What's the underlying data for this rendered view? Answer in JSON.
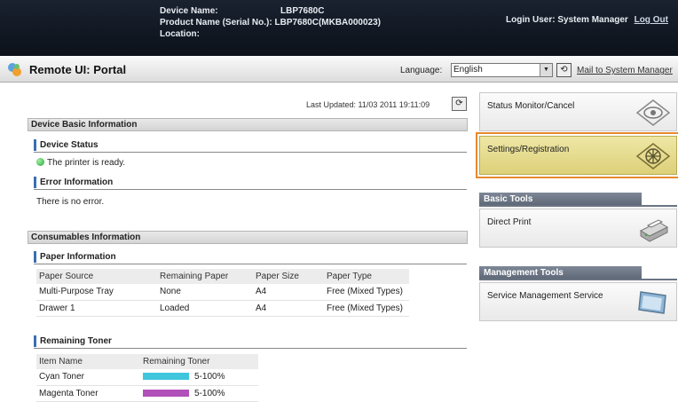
{
  "header": {
    "device_name_label": "Device Name:",
    "device_name": "LBP7680C",
    "product_name_label": "Product Name (Serial No.):",
    "product_name": "LBP7680C(MKBA000023)",
    "location_label": "Location:",
    "login_text": "Login User: System Manager",
    "logout_link": "Log Out"
  },
  "portal_bar": {
    "title": "Remote UI: Portal",
    "language_label": "Language:",
    "language_value": "English",
    "mail_link": "Mail to System Manager"
  },
  "main": {
    "last_updated": "Last Updated: 11/03 2011 19:11:09",
    "device_basic": {
      "title": "Device Basic Information",
      "status_title": "Device Status",
      "status_text": "The printer is ready.",
      "error_title": "Error Information",
      "error_text": "There is no error."
    },
    "consumables": {
      "title": "Consumables Information",
      "paper_title": "Paper Information",
      "paper_headers": [
        "Paper Source",
        "Remaining Paper",
        "Paper Size",
        "Paper Type"
      ],
      "paper_rows": [
        [
          "Multi-Purpose Tray",
          "None",
          "A4",
          "Free (Mixed Types)"
        ],
        [
          "Drawer 1",
          "Loaded",
          "A4",
          "Free (Mixed Types)"
        ]
      ],
      "toner_title": "Remaining Toner",
      "toner_headers": [
        "Item Name",
        "Remaining Toner"
      ],
      "toner_rows": [
        {
          "name": "Cyan Toner",
          "level": "5-100%",
          "color": "#3fc6dc"
        },
        {
          "name": "Magenta Toner",
          "level": "5-100%",
          "color": "#b050b8"
        }
      ]
    }
  },
  "sidebar": {
    "status_monitor": "Status Monitor/Cancel",
    "settings": "Settings/Registration",
    "basic_tools_title": "Basic Tools",
    "direct_print": "Direct Print",
    "management_tools_title": "Management Tools",
    "service_management": "Service Management Service"
  }
}
